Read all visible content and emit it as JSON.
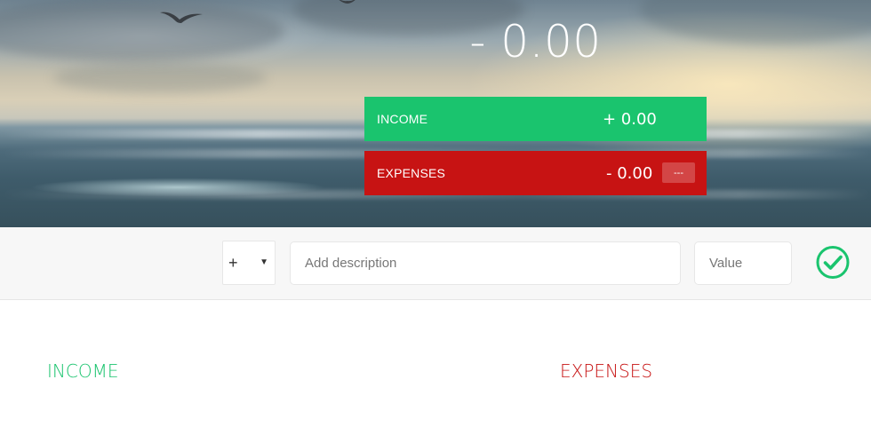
{
  "budget": {
    "total": "- 0.00"
  },
  "income_panel": {
    "label": "Income",
    "value": "+ 0.00"
  },
  "expenses_panel": {
    "label": "Expenses",
    "value": "- 0.00",
    "percentage": "---"
  },
  "add_form": {
    "type_value": "+",
    "description_placeholder": "Add description",
    "value_placeholder": "Value"
  },
  "lists": {
    "income_title": "Income",
    "expenses_title": "Expenses"
  },
  "colors": {
    "income": "#1ac46e",
    "expenses": "#c71313",
    "check": "#1ac46e"
  },
  "icons": {
    "add": "check-circle-icon",
    "select": "caret-down-icon"
  }
}
